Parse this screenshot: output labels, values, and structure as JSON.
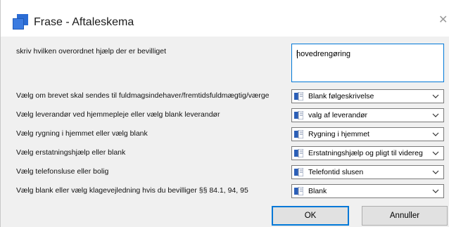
{
  "window": {
    "title": "Frase - Aftaleskema"
  },
  "icons": {
    "app": "window-app-icon",
    "close": "close-icon",
    "doc": "document-icon",
    "dropdown": "chevron-down-icon"
  },
  "colors": {
    "accent": "#0078d7",
    "icon_blue": "#2b6cd4"
  },
  "form": {
    "help_label": "skriv hvilken overordnet hjælp der er bevilliget",
    "help_value": "hovedrengøring",
    "rows": [
      {
        "label": "Vælg om brevet skal sendes til fuldmagsindehaver/fremtidsfuldmægtig/værge",
        "value": "Blank følgeskrivelse"
      },
      {
        "label": "Vælg leverandør ved hjemmepleje eller vælg blank leverandør",
        "value": "valg af leverandør"
      },
      {
        "label": "Vælg rygning i hjemmet eller vælg blank",
        "value": "Rygning i hjemmet"
      },
      {
        "label": "Vælg erstatningshjælp eller blank",
        "value": "Erstatningshjælp og pligt til videreg"
      },
      {
        "label": "Vælg  telefonsluse eller bolig",
        "value": "Telefontid slusen"
      },
      {
        "label": "Vælg blank eller vælg klagevejledning hvis du bevilliger §§ 84.1, 94, 95",
        "value": "Blank"
      }
    ]
  },
  "buttons": {
    "ok": "OK",
    "cancel": "Annuller"
  }
}
